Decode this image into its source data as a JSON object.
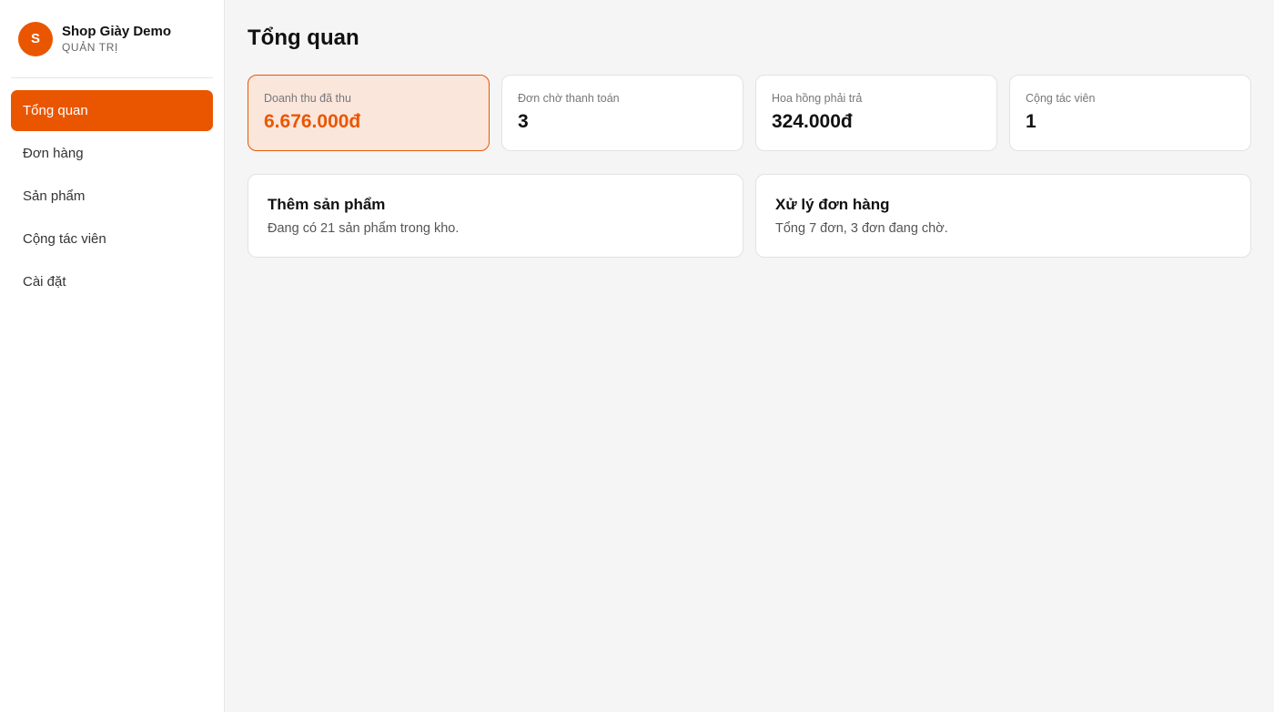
{
  "brand": {
    "avatar_letter": "S",
    "name": "Shop Giày Demo",
    "role": "QUẢN TRỊ"
  },
  "nav": {
    "items": [
      {
        "label": "Tổng quan",
        "active": true
      },
      {
        "label": "Đơn hàng",
        "active": false
      },
      {
        "label": "Sản phẩm",
        "active": false
      },
      {
        "label": "Cộng tác viên",
        "active": false
      },
      {
        "label": "Cài đặt",
        "active": false
      }
    ]
  },
  "page": {
    "title": "Tổng quan"
  },
  "stats": [
    {
      "label": "Doanh thu đã thu",
      "value": "6.676.000đ"
    },
    {
      "label": "Đơn chờ thanh toán",
      "value": "3"
    },
    {
      "label": "Hoa hồng phải trả",
      "value": "324.000đ"
    },
    {
      "label": "Cộng tác viên",
      "value": "1"
    }
  ],
  "actions": [
    {
      "title": "Thêm sản phẩm",
      "desc": "Đang có 21 sản phẩm trong kho."
    },
    {
      "title": "Xử lý đơn hàng",
      "desc": "Tổng 7 đơn, 3 đơn đang chờ."
    }
  ],
  "colors": {
    "accent": "#ea5600",
    "highlight_bg": "#fbe6dc",
    "background": "#f5f5f5"
  }
}
